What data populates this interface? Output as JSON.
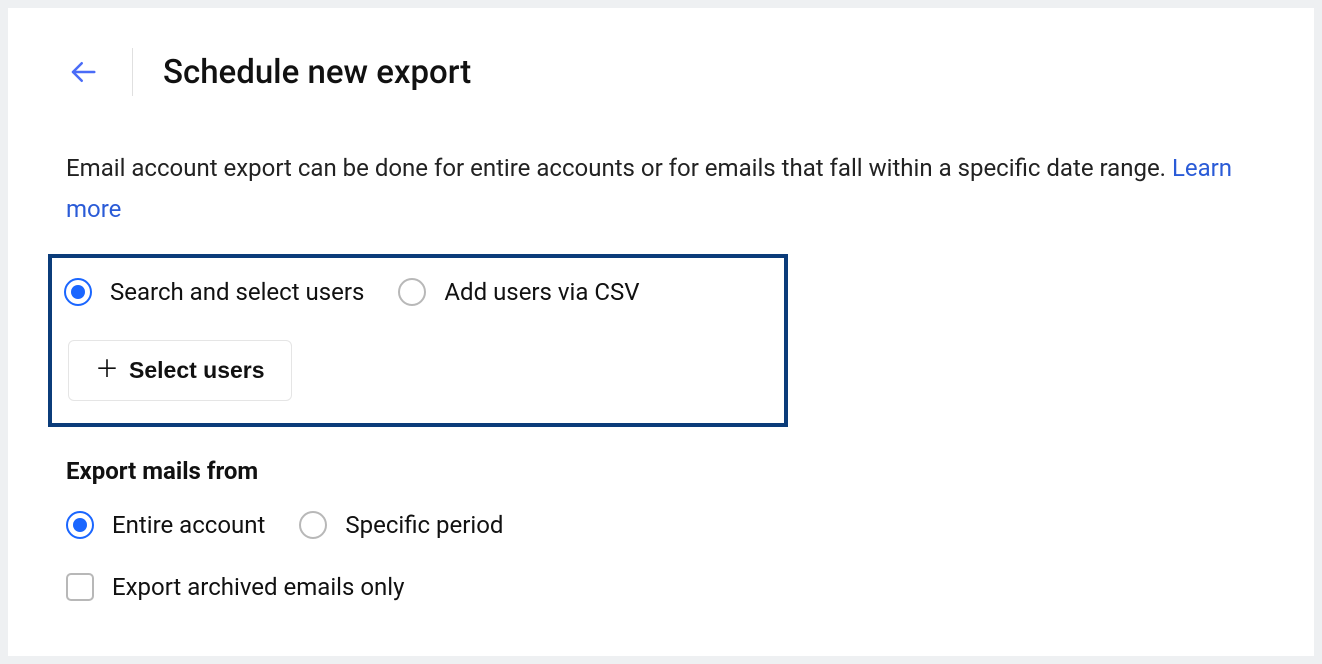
{
  "header": {
    "title": "Schedule new export"
  },
  "description": {
    "text": "Email account export can be done for entire accounts or for emails that fall within a specific date range. ",
    "learn_more": "Learn more"
  },
  "user_selection": {
    "radio_search": "Search and select users",
    "radio_csv": "Add users via CSV",
    "select_users_button": "Select users"
  },
  "export_from": {
    "heading": "Export mails from",
    "radio_entire": "Entire account",
    "radio_specific": "Specific period",
    "checkbox_archived": "Export archived emails only"
  }
}
